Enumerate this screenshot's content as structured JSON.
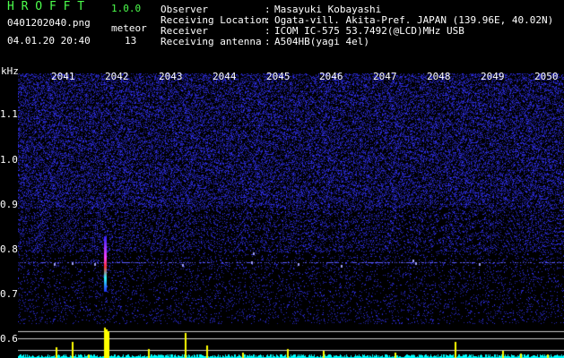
{
  "header": {
    "app_title": "H R O F F T",
    "version": "1.0.0",
    "filename": "0401202040.png",
    "meteor_label": "meteor",
    "datetime": "04.01.20 20:40",
    "meteor_count": "13"
  },
  "info": {
    "rows": [
      {
        "label": "Observer",
        "sep": ":",
        "value": "Masayuki Kobayashi"
      },
      {
        "label": "Receiving Location",
        "sep": ":",
        "value": "Ogata-vill. Akita-Pref. JAPAN (139.96E, 40.02N)"
      },
      {
        "label": "Receiver",
        "sep": ":",
        "value": "ICOM IC-575 53.7492(@LCD)MHz USB"
      },
      {
        "label": "Receiving antenna",
        "sep": ":",
        "value": "A504HB(yagi 4el)"
      }
    ]
  },
  "axes": {
    "y_unit": "kHz",
    "y_ticks": [
      "1.1",
      "1.0",
      "0.9",
      "0.8",
      "0.7",
      "0.6"
    ],
    "x_ticks": [
      "2041",
      "2042",
      "2043",
      "2044",
      "2045",
      "2046",
      "2047",
      "2048",
      "2049",
      "2050"
    ]
  },
  "colors": {
    "background": "#000000",
    "noise": "#3030ff",
    "title_green": "#4cff4c",
    "meteor_yellow": "#ffff00",
    "baseline_cyan": "#00ffff"
  }
}
